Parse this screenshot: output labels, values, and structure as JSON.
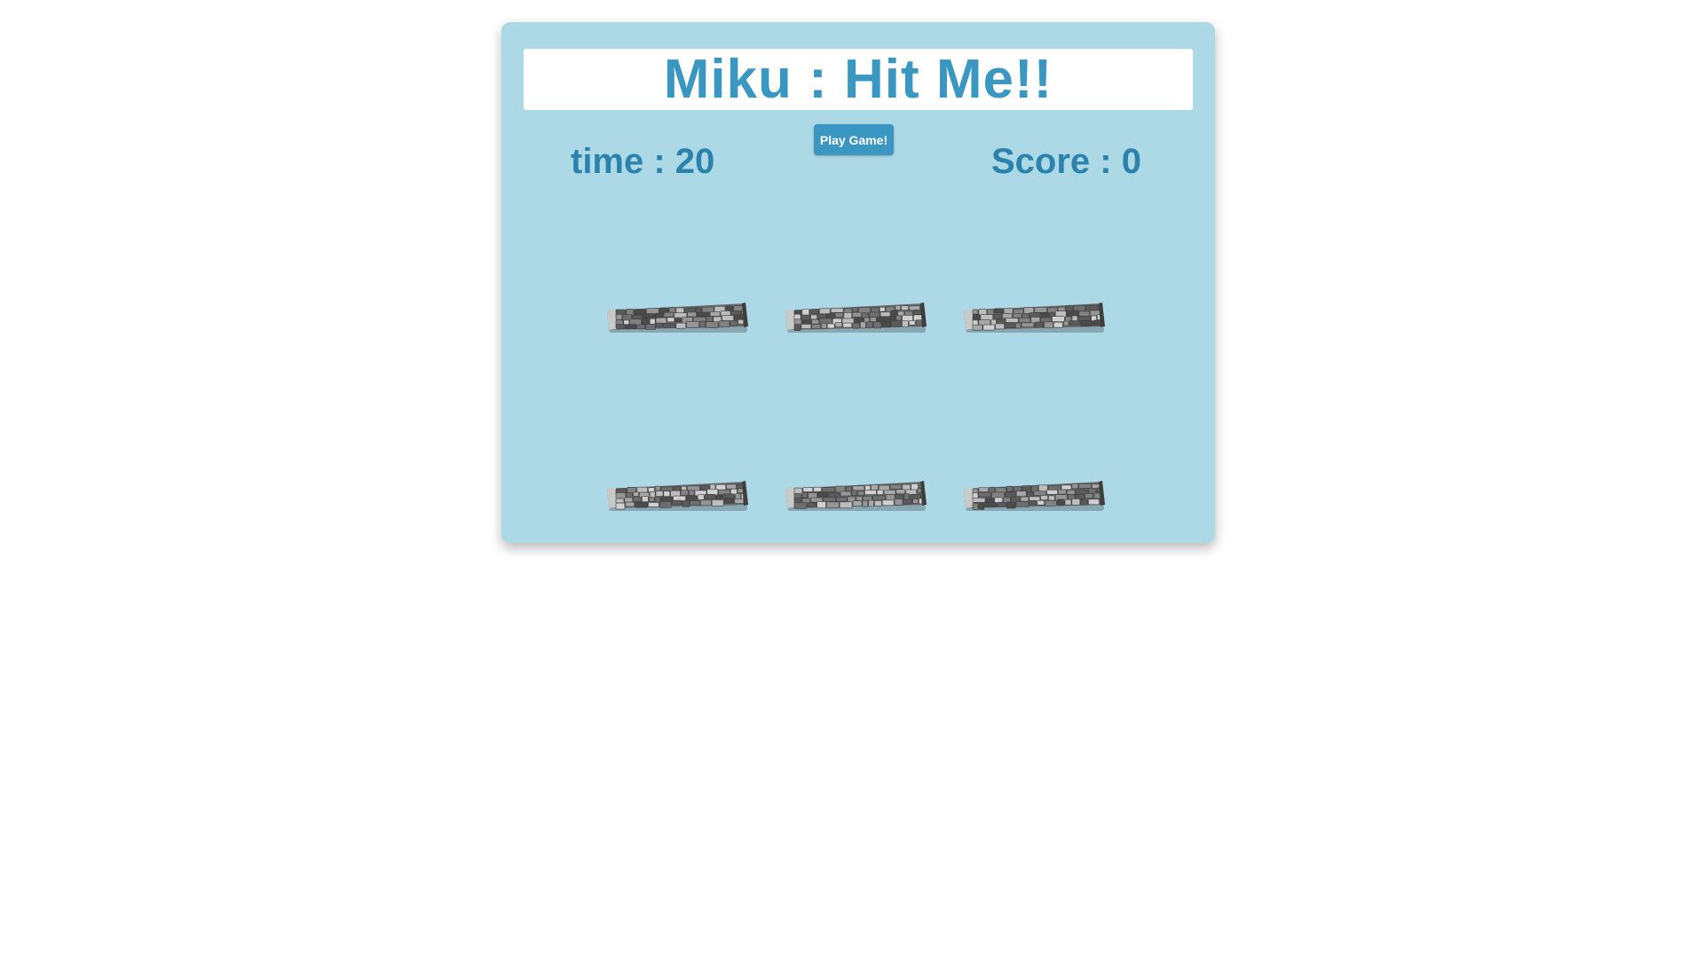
{
  "game": {
    "title": "Miku : Hit Me!!",
    "time_label": "time : 20",
    "score_label": "Score : 0",
    "play_button_label": "Play Game!"
  },
  "holes": [
    {
      "id": "hole-1"
    },
    {
      "id": "hole-2"
    },
    {
      "id": "hole-3"
    },
    {
      "id": "hole-4"
    },
    {
      "id": "hole-5"
    },
    {
      "id": "hole-6"
    }
  ],
  "colors": {
    "panel_background": "#add8e6",
    "title_text": "#3a97c2",
    "stat_text": "#2a82ad",
    "button_background": "#3a97c2",
    "button_text": "#ffffff"
  }
}
